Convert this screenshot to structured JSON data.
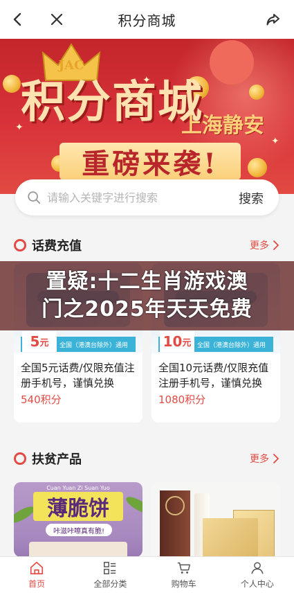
{
  "header": {
    "title": "积分商城"
  },
  "banner": {
    "badge_text": "JAC",
    "headline": "积分商城",
    "city": "上海静安",
    "subheadline": "重磅来袭!"
  },
  "search": {
    "placeholder": "请输入关键字进行搜索",
    "button_label": "搜索"
  },
  "overlay": {
    "line1": "置疑:十二生肖游戏澳",
    "line2": "门之2025年天天免费"
  },
  "sections": [
    {
      "title": "话费充值",
      "more_label": "更多",
      "items": [
        {
          "amount": "5",
          "unit": "元",
          "scope": "全国（港澳台除外）通用",
          "name": "全国5元话费/仅限充值注册手机号，谨慎兑换",
          "price": "540积分"
        },
        {
          "amount": "10",
          "unit": "元",
          "scope": "全国（港澳台除外）通用",
          "name": "全国10元话费/仅限充值注册手机号，谨慎兑换",
          "price": "1080积分"
        }
      ]
    },
    {
      "title": "扶贫产品",
      "more_label": "更多",
      "items": [
        {
          "brand": "Cuan Yuan Zi Suan Yuo",
          "image_title": "薄脆饼",
          "image_tag": "咔滋咔嚓真有脆!"
        },
        {}
      ]
    }
  ],
  "tabbar": {
    "items": [
      {
        "label": "首页",
        "icon": "home-icon",
        "active": true
      },
      {
        "label": "全部分类",
        "icon": "category-icon",
        "active": false
      },
      {
        "label": "购物车",
        "icon": "cart-icon",
        "active": false
      },
      {
        "label": "个人中心",
        "icon": "user-icon",
        "active": false
      }
    ]
  },
  "colors": {
    "accent": "#e24a43",
    "banner_red": "#c3262b"
  }
}
